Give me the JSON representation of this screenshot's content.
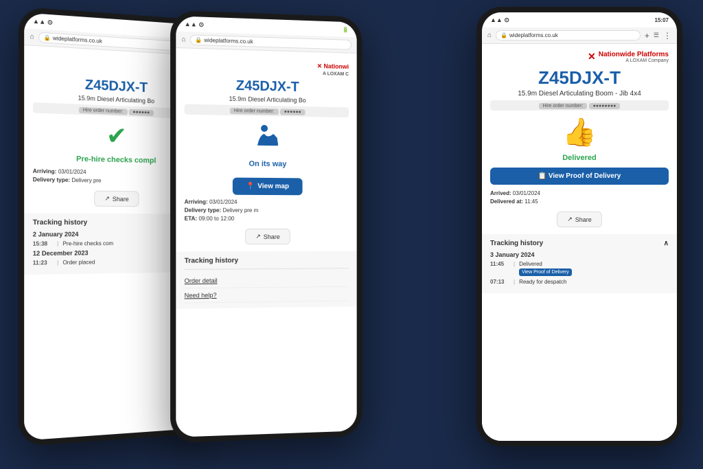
{
  "brand": {
    "name": "Nationwide Platforms",
    "sub": "A LOXAM Company",
    "logo_symbol": "✕"
  },
  "machine": {
    "id": "Z45DJX-T",
    "description": "15.9m Diesel Articulating Boom - Jib 4x4",
    "hire_order_label": "Hire order number:",
    "hire_order_value": "●●●●●●●●"
  },
  "phones": {
    "left": {
      "status_bar": "▲▲ ▼ ⊙",
      "url": "wideplatforms.co.uk",
      "machine_id": "Z45DJX-T",
      "machine_desc": "15.9m Diesel Articulating Bo",
      "hire_order_label": "Hire order number:",
      "status_icon": "✔",
      "status_text": "Pre-hire checks compl",
      "arriving_label": "Arriving:",
      "arriving_value": "03/01/2024",
      "delivery_type_label": "Delivery type:",
      "delivery_type_value": "Delivery pre",
      "share_label": "Share",
      "tracking_history_label": "Tracking history",
      "tracking_date_1": "2 January 2024",
      "tracking_time_1": "15:38",
      "tracking_desc_1": "Pre-hire checks com",
      "tracking_date_2": "12 December 2023",
      "tracking_time_2": "11:23",
      "tracking_desc_2": "Order placed"
    },
    "middle": {
      "status_bar": "▲▲ ▼ ⊙",
      "url": "wideplatforms.co.uk",
      "machine_id": "Z45DJX-T",
      "machine_desc": "15.9m Diesel Articulating Bo",
      "hire_order_label": "Hire order number:",
      "status_icon": "🧍",
      "status_text": "On its way",
      "view_map_label": "View map",
      "arriving_label": "Arriving:",
      "arriving_value": "03/01/2024",
      "delivery_type_label": "Delivery type:",
      "delivery_type_value": "Delivery pre m",
      "eta_label": "ETA:",
      "eta_value": "09:00 to 12:00",
      "share_label": "Share",
      "tracking_history_label": "Tracking history",
      "order_detail_label": "Order detail",
      "need_help_label": "Need help?"
    },
    "right": {
      "status_bar": "15:07",
      "url": "wideplatforms.co.uk",
      "machine_id": "Z45DJX-T",
      "machine_desc": "15.9m Diesel Articulating Boom - Jib 4x4",
      "hire_order_label": "Hire order number:",
      "status_icon": "👍",
      "status_text": "Delivered",
      "view_pod_label": "View Proof of Delivery",
      "arrived_label": "Arrived:",
      "arrived_value": "03/01/2024",
      "delivered_at_label": "Delivered at:",
      "delivered_at_value": "11:45",
      "share_label": "Share",
      "tracking_history_label": "Tracking history",
      "tracking_history_chevron": "∧",
      "tracking_date_1": "3 January 2024",
      "tracking_time_1": "11:45",
      "tracking_desc_1": "Delivered",
      "tracking_pod_label": "View Proof of Delivery",
      "tracking_time_2": "07:13",
      "tracking_desc_2": "Ready for despatch"
    }
  },
  "colors": {
    "accent_blue": "#1a5fa8",
    "accent_green": "#2ca44e",
    "accent_red": "#cc0000",
    "bg_dark": "#1a2a4a",
    "bg_light": "#f7f7f7"
  }
}
